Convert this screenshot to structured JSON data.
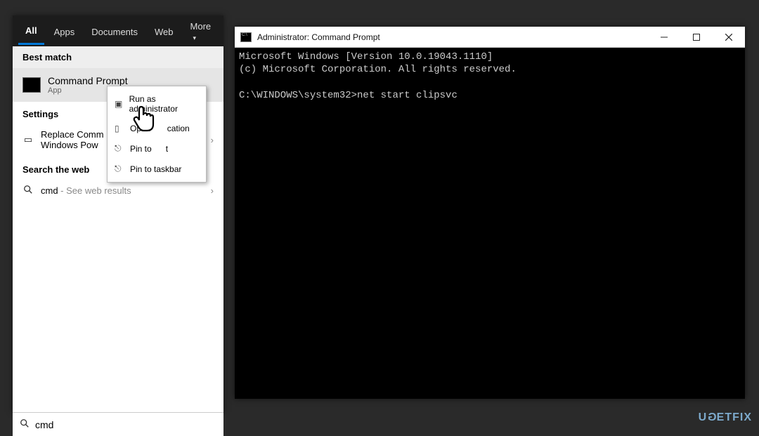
{
  "start": {
    "tabs": [
      "All",
      "Apps",
      "Documents",
      "Web",
      "More"
    ],
    "best_match_header": "Best match",
    "best_match": {
      "title": "Command Prompt",
      "subtitle": "App"
    },
    "settings_header": "Settings",
    "settings_item": "Replace Command Prompt with Windows PowerShell...",
    "settings_item_short1": "Replace Comm",
    "settings_item_short2": "Windows Pow",
    "web_header": "Search the web",
    "web_item_main": "cmd",
    "web_item_tail": " - See web results"
  },
  "context_menu": {
    "items": [
      "Run as administrator",
      "Open file location",
      "Pin to Start",
      "Pin to taskbar"
    ],
    "items_partial": [
      "Run as administrator",
      "Open",
      "cation",
      "Pin to",
      "t",
      "Pin to taskbar"
    ]
  },
  "search": {
    "value": "cmd"
  },
  "cmd": {
    "title": "Administrator: Command Prompt",
    "line1": "Microsoft Windows [Version 10.0.19043.1110]",
    "line2": "(c) Microsoft Corporation. All rights reserved.",
    "prompt": "C:\\WINDOWS\\system32>",
    "typed": "net start clipsvc"
  },
  "watermark": "UGETFIX"
}
